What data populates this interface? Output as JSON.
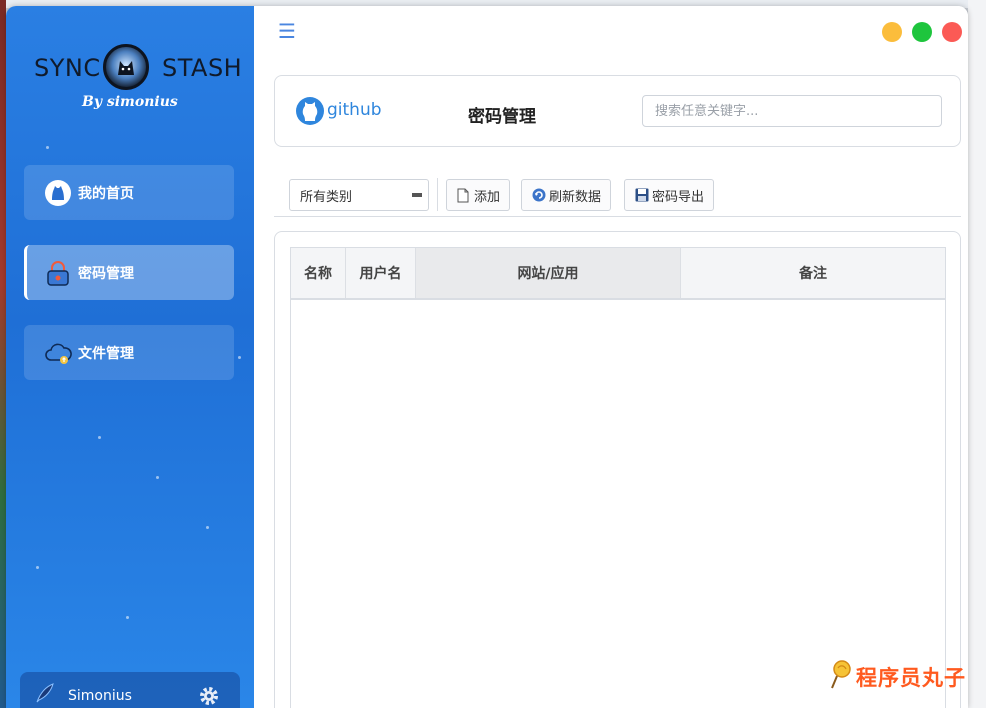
{
  "app": {
    "logo_left": "SYNC",
    "logo_right": "STASH",
    "logo_sub": "By simonius",
    "accent": "#2a7fe3"
  },
  "sidebar": {
    "items": [
      {
        "label": "我的首页",
        "icon": "github-cat-icon",
        "active": false
      },
      {
        "label": "密码管理",
        "icon": "lock-icon",
        "active": true
      },
      {
        "label": "文件管理",
        "icon": "cloud-upload-icon",
        "active": false
      }
    ],
    "user": {
      "name": "Simonius",
      "icon": "feather-icon",
      "settings_icon": "gear-icon"
    }
  },
  "window_controls": {
    "minimize_color": "#fbbd3c",
    "maximize_color": "#1ec53d",
    "close_color": "#fb5a55"
  },
  "header": {
    "brand": "github",
    "title": "密码管理",
    "search_placeholder": "搜索任意关键字..."
  },
  "toolbar": {
    "category_value": "所有类别",
    "add_label": "添加",
    "refresh_label": "刷新数据",
    "export_label": "密码导出"
  },
  "table": {
    "columns": [
      "名称",
      "用户名",
      "网站/应用",
      "备注"
    ],
    "rows": []
  },
  "watermark": "程序员丸子"
}
